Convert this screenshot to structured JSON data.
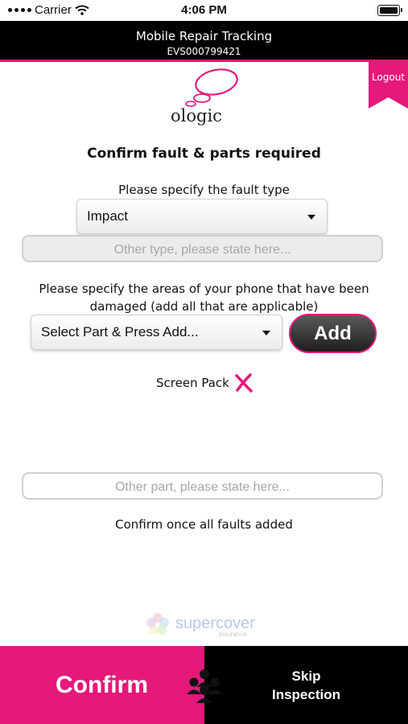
{
  "status_bar": {
    "carrier": "Carrier",
    "time": "4:06 PM"
  },
  "header": {
    "title": "Mobile Repair Tracking",
    "reference": "EVS000799421",
    "logout_label": "Logout"
  },
  "logo": {
    "text": "ologic"
  },
  "page": {
    "heading": "Confirm fault & parts required",
    "fault_label": "Please specify the fault type",
    "fault_type_selected": "Impact",
    "other_type_placeholder": "Other type, please state here...",
    "areas_label": "Please specify the areas of your phone that have been damaged (add all that are applicable)",
    "part_select_selected": "Select Part & Press Add...",
    "add_label": "Add",
    "added_parts": [
      {
        "label": "Screen Pack"
      }
    ],
    "other_part_placeholder": "Other part, please state here...",
    "confirm_note": "Confirm once all faults added"
  },
  "sponsor": {
    "name": "supercover",
    "sub": "insurance"
  },
  "footer": {
    "confirm_label": "Confirm",
    "skip_line1": "Skip",
    "skip_line2": "Inspection"
  },
  "colors": {
    "accent": "#e4197b",
    "header_bg": "#000000"
  }
}
